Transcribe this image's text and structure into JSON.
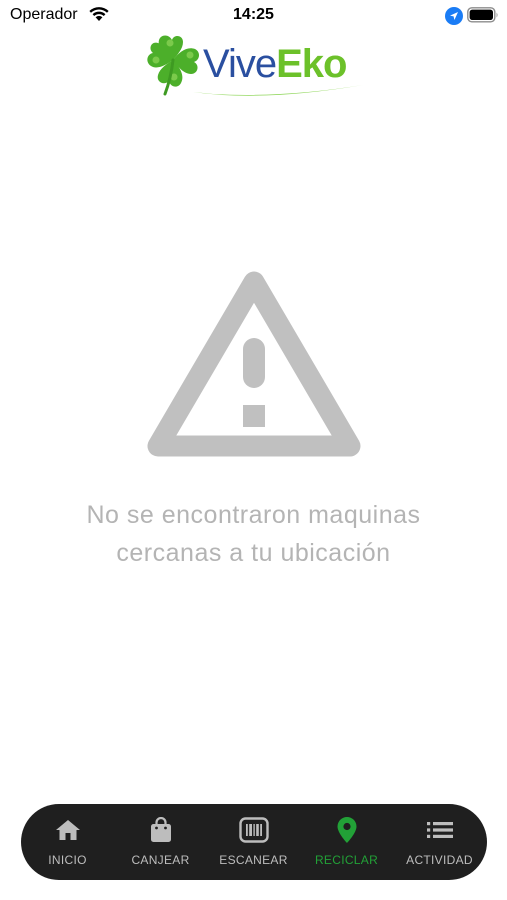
{
  "status_bar": {
    "carrier": "Operador",
    "time": "14:25",
    "icons": [
      "wifi-icon",
      "location-arrow-icon",
      "battery-icon"
    ]
  },
  "logo": {
    "part1": "Vive",
    "part2": "Eko",
    "colors": {
      "vive": "#2a4fa0",
      "eko": "#6cc12a",
      "clover": "#4caf2a"
    }
  },
  "empty_state": {
    "icon": "warning-triangle-icon",
    "message_line1": "No se encontraron maquinas",
    "message_line2": "cercanas a tu ubicación"
  },
  "tab_bar": {
    "active_color": "#22a137",
    "tabs": [
      {
        "label": "INICIO",
        "icon": "home-icon",
        "active": false
      },
      {
        "label": "CANJEAR",
        "icon": "shopping-bag-icon",
        "active": false
      },
      {
        "label": "ESCANEAR",
        "icon": "barcode-scan-icon",
        "active": false
      },
      {
        "label": "RECICLAR",
        "icon": "map-pin-icon",
        "active": true
      },
      {
        "label": "ACTIVIDAD",
        "icon": "list-icon",
        "active": false
      }
    ]
  }
}
